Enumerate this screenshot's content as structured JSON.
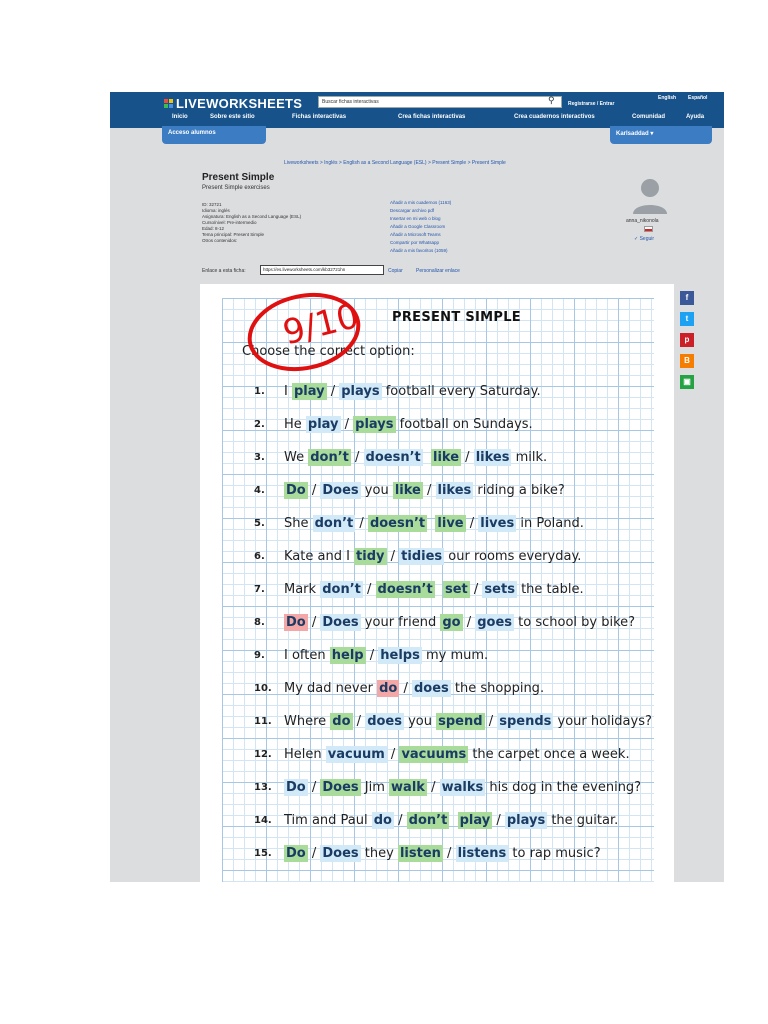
{
  "header": {
    "logo": "LIVEWORKSHEETS",
    "search_placeholder": "Buscar fichas interactivas",
    "register_label": "Registrarse / Entrar",
    "lang_english": "English",
    "lang_spanish": "Español",
    "nav": [
      "Inicio",
      "Sobre este sitio",
      "Fichas interactivas",
      "Crea fichas interactivas",
      "Crea cuadernos interactivos",
      "Comunidad",
      "Ayuda"
    ],
    "students_button": "Acceso alumnos",
    "user_button": "Karlsaddad"
  },
  "info": {
    "breadcrumb": "Liveworksheets > Inglés > English as a Second Language (ESL) > Present Simple > Present Simple",
    "title": "Present Simple",
    "subtitle": "Present Simple exercises",
    "meta": [
      "ID: 32721",
      "Idioma: inglés",
      "Asignatura: English as a Second Language (ESL)",
      "Curso/nivel: Pre-intermedio",
      "Edad: 8-12",
      "Tema principal: Present Simple",
      "Otros contenidos:"
    ],
    "actions": [
      "Añadir a mis cuadernos (1163)",
      "Descargar archivo pdf",
      "Insertar en mi web o blog",
      "Añadir a Google Classroom",
      "Añadir a Microsoft Teams",
      "Compartir por Whatsapp",
      "Añadir a mis favoritos (1059)"
    ],
    "author": "anna_nikonola",
    "follow": "Seguir",
    "share_label": "Enlace a esta ficha:",
    "share_url": "https://es.liveworksheets.com/kb32721hn",
    "copy": "Copiar",
    "custom": "Personalizar enlace"
  },
  "social": [
    {
      "name": "facebook-icon",
      "glyph": "f",
      "color": "#3b5998"
    },
    {
      "name": "twitter-icon",
      "glyph": "t",
      "color": "#1da1f2"
    },
    {
      "name": "pinterest-icon",
      "glyph": "p",
      "color": "#cb2027"
    },
    {
      "name": "blogger-icon",
      "glyph": "B",
      "color": "#f57d00"
    },
    {
      "name": "classroom-icon",
      "glyph": "▣",
      "color": "#25a244"
    }
  ],
  "worksheet": {
    "score": "9/10",
    "title": "PRESENT SIMPLE",
    "instruction": "Choose the correct option:",
    "items": [
      {
        "num": "1.",
        "parts": [
          {
            "t": "I "
          },
          {
            "o": "play",
            "s": "correct"
          },
          {
            "t": " / "
          },
          {
            "o": "plays",
            "s": "plain"
          },
          {
            "t": " football every Saturday."
          }
        ]
      },
      {
        "num": "2.",
        "parts": [
          {
            "t": "He "
          },
          {
            "o": "play",
            "s": "plain"
          },
          {
            "t": " / "
          },
          {
            "o": "plays",
            "s": "correct"
          },
          {
            "t": " football on Sundays."
          }
        ]
      },
      {
        "num": "3.",
        "parts": [
          {
            "t": "We "
          },
          {
            "o": "don’t",
            "s": "correct"
          },
          {
            "t": " / "
          },
          {
            "o": "doesn’t",
            "s": "plain"
          },
          {
            "t": "  "
          },
          {
            "o": "like",
            "s": "correct"
          },
          {
            "t": " / "
          },
          {
            "o": "likes",
            "s": "plain"
          },
          {
            "t": " milk."
          }
        ]
      },
      {
        "num": "4.",
        "parts": [
          {
            "o": "Do",
            "s": "correct"
          },
          {
            "t": " / "
          },
          {
            "o": "Does",
            "s": "plain"
          },
          {
            "t": " you "
          },
          {
            "o": "like",
            "s": "correct"
          },
          {
            "t": " / "
          },
          {
            "o": "likes",
            "s": "plain"
          },
          {
            "t": " riding a bike?"
          }
        ]
      },
      {
        "num": "5.",
        "parts": [
          {
            "t": "She "
          },
          {
            "o": "don’t",
            "s": "plain"
          },
          {
            "t": " / "
          },
          {
            "o": "doesn’t",
            "s": "correct"
          },
          {
            "t": "  "
          },
          {
            "o": "live",
            "s": "correct"
          },
          {
            "t": " / "
          },
          {
            "o": "lives",
            "s": "plain"
          },
          {
            "t": " in Poland."
          }
        ]
      },
      {
        "num": "6.",
        "parts": [
          {
            "t": "Kate and I "
          },
          {
            "o": "tidy",
            "s": "correct"
          },
          {
            "t": " / "
          },
          {
            "o": "tidies",
            "s": "plain"
          },
          {
            "t": " our rooms everyday."
          }
        ]
      },
      {
        "num": "7.",
        "parts": [
          {
            "t": "Mark "
          },
          {
            "o": "don’t",
            "s": "plain"
          },
          {
            "t": " / "
          },
          {
            "o": "doesn’t",
            "s": "correct"
          },
          {
            "t": "  "
          },
          {
            "o": "set",
            "s": "correct"
          },
          {
            "t": " / "
          },
          {
            "o": "sets",
            "s": "plain"
          },
          {
            "t": " the table."
          }
        ]
      },
      {
        "num": "8.",
        "parts": [
          {
            "o": "Do",
            "s": "wrong"
          },
          {
            "t": " / "
          },
          {
            "o": "Does",
            "s": "plain"
          },
          {
            "t": " your friend "
          },
          {
            "o": "go",
            "s": "correct"
          },
          {
            "t": " / "
          },
          {
            "o": "goes",
            "s": "plain"
          },
          {
            "t": " to school by bike?"
          }
        ]
      },
      {
        "num": "9.",
        "parts": [
          {
            "t": "I often "
          },
          {
            "o": "help",
            "s": "correct"
          },
          {
            "t": " / "
          },
          {
            "o": "helps",
            "s": "plain"
          },
          {
            "t": " my mum."
          }
        ]
      },
      {
        "num": "10.",
        "parts": [
          {
            "t": "My dad never "
          },
          {
            "o": "do",
            "s": "wrong"
          },
          {
            "t": " / "
          },
          {
            "o": "does",
            "s": "plain"
          },
          {
            "t": " the shopping."
          }
        ]
      },
      {
        "num": "11.",
        "parts": [
          {
            "t": "Where "
          },
          {
            "o": "do",
            "s": "correct"
          },
          {
            "t": " / "
          },
          {
            "o": "does",
            "s": "plain"
          },
          {
            "t": " you "
          },
          {
            "o": "spend",
            "s": "correct"
          },
          {
            "t": " / "
          },
          {
            "o": "spends",
            "s": "plain"
          },
          {
            "t": " your holidays?"
          }
        ]
      },
      {
        "num": "12.",
        "parts": [
          {
            "t": "Helen "
          },
          {
            "o": "vacuum",
            "s": "plain"
          },
          {
            "t": " / "
          },
          {
            "o": "vacuums",
            "s": "correct"
          },
          {
            "t": " the carpet once a week."
          }
        ]
      },
      {
        "num": "13.",
        "parts": [
          {
            "o": "Do",
            "s": "plain"
          },
          {
            "t": " / "
          },
          {
            "o": "Does",
            "s": "correct"
          },
          {
            "t": " Jim "
          },
          {
            "o": "walk",
            "s": "correct"
          },
          {
            "t": " / "
          },
          {
            "o": "walks",
            "s": "plain"
          },
          {
            "t": " his dog in the evening?"
          }
        ]
      },
      {
        "num": "14.",
        "parts": [
          {
            "t": "Tim and Paul "
          },
          {
            "o": "do",
            "s": "plain"
          },
          {
            "t": " / "
          },
          {
            "o": "don’t",
            "s": "correct"
          },
          {
            "t": "  "
          },
          {
            "o": "play",
            "s": "correct"
          },
          {
            "t": " / "
          },
          {
            "o": "plays",
            "s": "plain"
          },
          {
            "t": " the guitar."
          }
        ]
      },
      {
        "num": "15.",
        "parts": [
          {
            "o": "Do",
            "s": "correct"
          },
          {
            "t": " / "
          },
          {
            "o": "Does",
            "s": "plain"
          },
          {
            "t": " they "
          },
          {
            "o": "listen",
            "s": "correct"
          },
          {
            "t": " / "
          },
          {
            "o": "listens",
            "s": "plain"
          },
          {
            "t": " to rap music?"
          }
        ]
      }
    ]
  }
}
